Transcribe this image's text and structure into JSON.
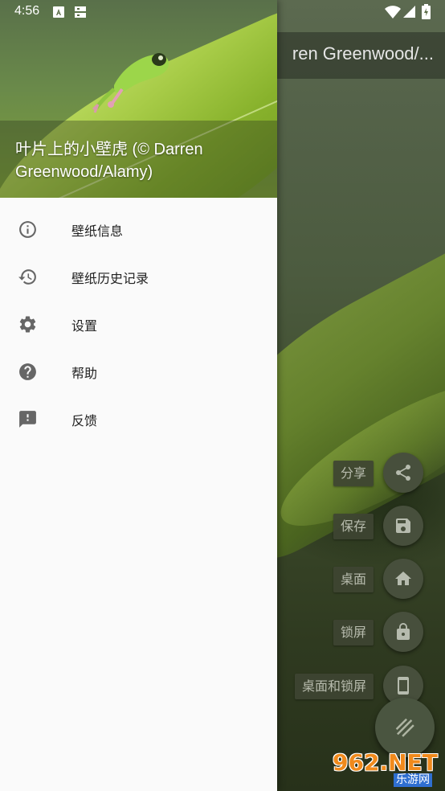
{
  "status_bar": {
    "time": "4:56",
    "left_icons": [
      "a-notification-icon",
      "sim-notification-icon"
    ],
    "right_icons": [
      "wifi-icon",
      "cell-signal-icon",
      "battery-icon"
    ]
  },
  "toolbar": {
    "title": "ren Greenwood/..."
  },
  "drawer": {
    "header_title": "叶片上的小壁虎 (© Darren Greenwood/Alamy)",
    "items": [
      {
        "label": "壁纸信息",
        "icon": "info-icon"
      },
      {
        "label": "壁纸历史记录",
        "icon": "history-icon"
      },
      {
        "label": "设置",
        "icon": "gear-icon"
      },
      {
        "label": "帮助",
        "icon": "help-icon"
      },
      {
        "label": "反馈",
        "icon": "feedback-icon"
      }
    ]
  },
  "fab_actions": [
    {
      "label": "分享",
      "icon": "share-icon"
    },
    {
      "label": "保存",
      "icon": "save-icon"
    },
    {
      "label": "桌面",
      "icon": "home-icon"
    },
    {
      "label": "锁屏",
      "icon": "lock-icon"
    },
    {
      "label": "桌面和锁屏",
      "icon": "phone-icon"
    }
  ],
  "watermark": {
    "top": "962.NET",
    "bottom": "乐游网"
  },
  "colors": {
    "drawer_bg": "#fafafa",
    "icon_gray": "#666666",
    "fab_bg": "#474f3c",
    "scrim": "#3d4b2c"
  }
}
